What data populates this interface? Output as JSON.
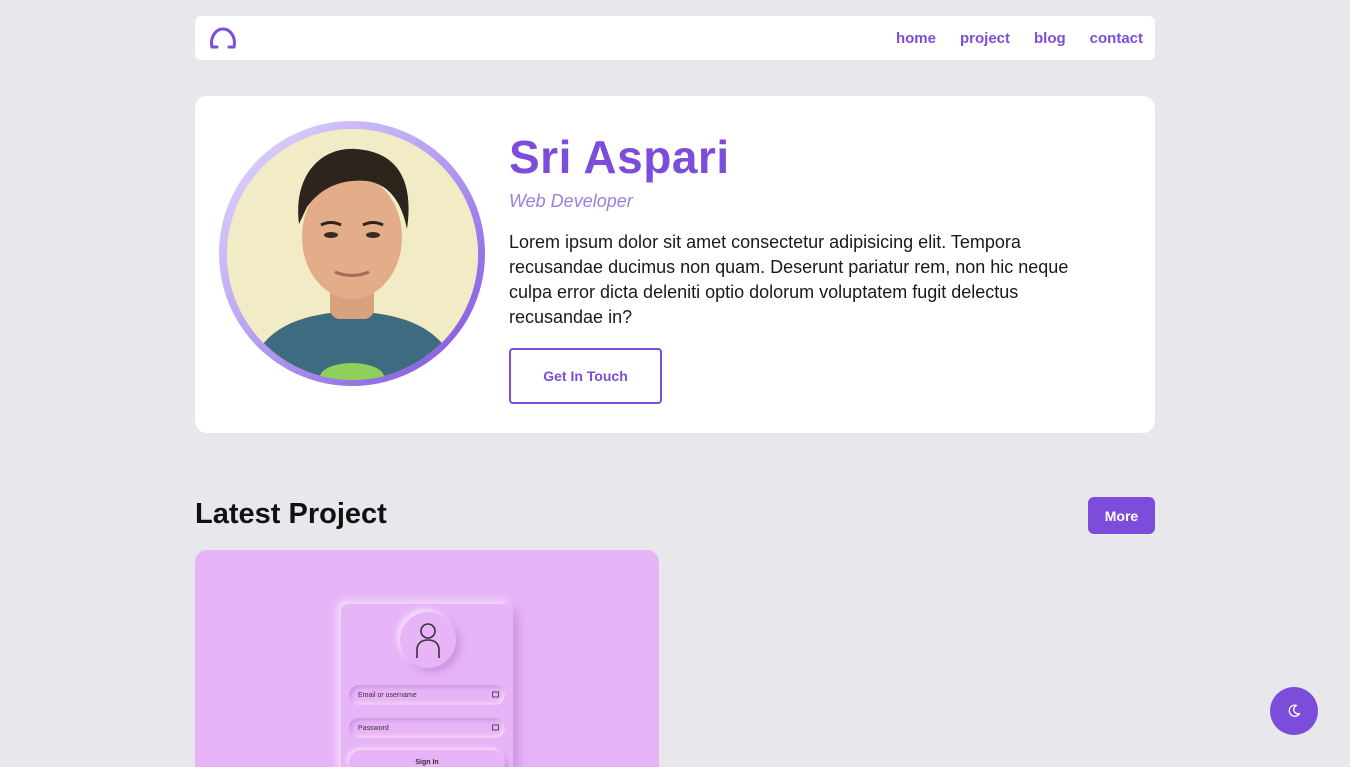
{
  "nav": {
    "links": [
      {
        "label": "home"
      },
      {
        "label": "project"
      },
      {
        "label": "blog"
      },
      {
        "label": "contact"
      }
    ]
  },
  "hero": {
    "name": "Sri Aspari",
    "role": "Web Developer",
    "description": "Lorem ipsum dolor sit amet consectetur adipisicing elit. Tempora recusandae ducimus non quam. Deserunt pariatur rem, non hic neque culpa error dicta deleniti optio dolorum voluptatem fugit delectus recusandae in?",
    "cta_label": "Get In Touch"
  },
  "projects": {
    "title": "Latest Project",
    "more_label": "More",
    "card": {
      "mock_username_placeholder": "Email or username",
      "mock_password_placeholder": "Password",
      "mock_signin_label": "Sign In"
    }
  },
  "colors": {
    "accent": "#7c4ddb",
    "background": "#e8e8ec",
    "card_bg": "#e8b4f8"
  },
  "icons": {
    "logo": "brand-logo-icon",
    "theme_toggle": "moon-icon"
  }
}
